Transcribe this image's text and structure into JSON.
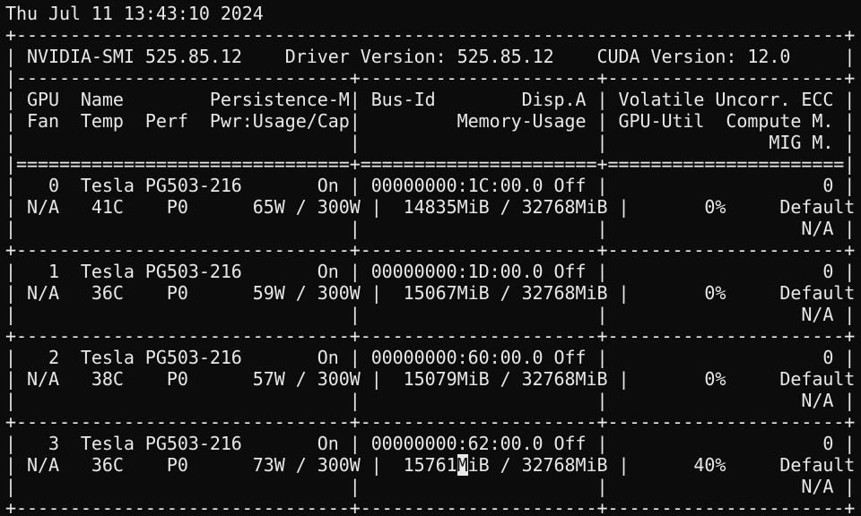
{
  "timestamp": "Thu Jul 11 13:43:10 2024",
  "smi_version": "525.85.12",
  "driver_version": "525.85.12",
  "cuda_version": "12.0",
  "gpus": [
    {
      "index": "0",
      "name": "Tesla PG503-216",
      "persistence": "On",
      "bus_id": "00000000:1C:00.0",
      "disp": "Off",
      "ecc": "0",
      "fan": "N/A",
      "temp": "41C",
      "perf": "P0",
      "pwr_usage": "65W",
      "pwr_cap": "300W",
      "mem_used": "14835MiB",
      "mem_total": "32768MiB",
      "util": "0%",
      "compute": "Default",
      "mig": "N/A"
    },
    {
      "index": "1",
      "name": "Tesla PG503-216",
      "persistence": "On",
      "bus_id": "00000000:1D:00.0",
      "disp": "Off",
      "ecc": "0",
      "fan": "N/A",
      "temp": "36C",
      "perf": "P0",
      "pwr_usage": "59W",
      "pwr_cap": "300W",
      "mem_used": "15067MiB",
      "mem_total": "32768MiB",
      "util": "0%",
      "compute": "Default",
      "mig": "N/A"
    },
    {
      "index": "2",
      "name": "Tesla PG503-216",
      "persistence": "On",
      "bus_id": "00000000:60:00.0",
      "disp": "Off",
      "ecc": "0",
      "fan": "N/A",
      "temp": "38C",
      "perf": "P0",
      "pwr_usage": "57W",
      "pwr_cap": "300W",
      "mem_used": "15079MiB",
      "mem_total": "32768MiB",
      "util": "0%",
      "compute": "Default",
      "mig": "N/A"
    },
    {
      "index": "3",
      "name": "Tesla PG503-216",
      "persistence": "On",
      "bus_id": "00000000:62:00.0",
      "disp": "Off",
      "ecc": "0",
      "fan": "N/A",
      "temp": "36C",
      "perf": "P0",
      "pwr_usage": "73W",
      "pwr_cap": "300W",
      "mem_used": "15761MiB",
      "mem_total": "32768MiB",
      "util": "40%",
      "compute": "Default",
      "mig": "N/A"
    }
  ],
  "colors": {
    "background": "#0c0c0c",
    "foreground": "#e8e8e8"
  }
}
